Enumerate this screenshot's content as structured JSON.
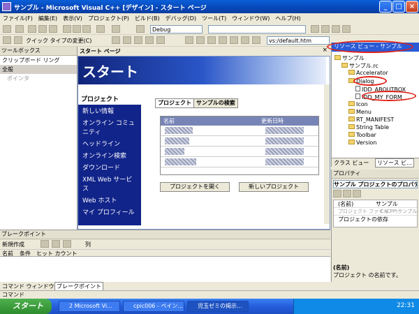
{
  "window": {
    "title": "サンプル - Microsoft Visual C++ [デザイン] - スタート ページ"
  },
  "menu": [
    "ファイル(F)",
    "編集(E)",
    "表示(V)",
    "プロジェクト(P)",
    "ビルド(B)",
    "デバッグ(D)",
    "ツール(T)",
    "ウィンドウ(W)",
    "ヘルプ(H)"
  ],
  "toolbar": {
    "config": "Debug",
    "url": "vs:/default.htm",
    "quickinfo": "クイック タイプの変更(C)"
  },
  "toolbox": {
    "title": "ツールボックス",
    "items": [
      "クリップボード リング",
      "全般",
      "ポインタ"
    ]
  },
  "startpage": {
    "tab": "スタート ページ",
    "banner": "スタート",
    "nav": [
      "プロジェクト",
      "新しい情報",
      "オンライン コミュニティ",
      "ヘッドライン",
      "オンライン検索",
      "ダウンロード",
      "XML Web サービス",
      "Web ホスト",
      "マイ プロフィール"
    ],
    "tabs": [
      "プロジェクト",
      "サンプルの検索"
    ],
    "columns": [
      "名前",
      "更新日時"
    ],
    "buttons": [
      "プロジェクトを開く",
      "新しいプロジェクト"
    ]
  },
  "resview": {
    "title": "リソース ビュー - サンプル",
    "tree": [
      "サンプル",
      "サンプル.rc",
      "Accelerator",
      "Dialog",
      "IDD_ABOUTBOX",
      "IDD_MY_FORM",
      "Icon",
      "Menu",
      "RT_MANIFEST",
      "String Table",
      "Toolbar",
      "Version"
    ],
    "tabs": [
      "クラス ビュー",
      "リソース ビ..."
    ]
  },
  "properties": {
    "title": "プロパティ",
    "selector": "サンプル プロジェクトのプロパティ",
    "rows": [
      [
        "(名前)",
        "サンプル"
      ],
      [
        "プロジェクト ファイル",
        "C:\\CPP\\サンプル"
      ],
      [
        "プロジェクトの依存",
        ""
      ]
    ],
    "desc_title": "(名前)",
    "desc_text": "プロジェクト の名前です。"
  },
  "breakpoint": {
    "title": "ブレークポイント",
    "new": "新規作成",
    "columns": "列",
    "headers": [
      "名前",
      "条件",
      "ヒット カウント"
    ]
  },
  "bottomtabs": [
    "コマンド ウィンドウ",
    "ブレークポイント"
  ],
  "status": "コマンド",
  "taskbar": {
    "start": "スタート",
    "tasks": [
      "2 Microsoft Vi...",
      "cpic006 - ペイン...",
      "児玉ゼミの掲示..."
    ],
    "clock": "22:31"
  }
}
